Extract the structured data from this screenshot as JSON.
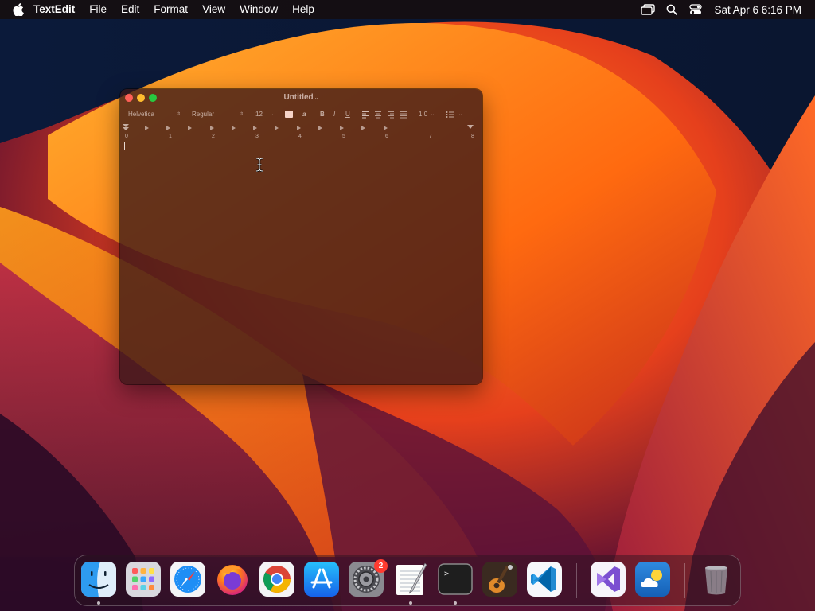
{
  "menubar": {
    "apple_icon": "apple-logo-icon",
    "app_name": "TextEdit",
    "items": [
      "File",
      "Edit",
      "Format",
      "View",
      "Window",
      "Help"
    ],
    "status_icons": [
      "screen-mirroring-icon",
      "spotlight-search-icon",
      "control-center-icon"
    ],
    "clock": "Sat Apr 6  6:16 PM"
  },
  "window": {
    "title": "Untitled",
    "traffic_lights": {
      "close": "#fe5f57",
      "minimize": "#febc2e",
      "zoom": "#28c840"
    },
    "toolbar": {
      "font_family": "Helvetica",
      "font_style": "Regular",
      "font_size": "12",
      "text_color": "#f5d3c8",
      "highlight_label": "a",
      "bold_label": "B",
      "italic_label": "I",
      "underline_label": "U",
      "line_spacing": "1.0"
    },
    "ruler": {
      "numbers": [
        "0",
        "1",
        "2",
        "3",
        "4",
        "5",
        "6",
        "7",
        "8"
      ]
    },
    "document_text": ""
  },
  "dock": {
    "apps": [
      {
        "name": "Finder",
        "icon": "finder-icon",
        "running": true
      },
      {
        "name": "Launchpad",
        "icon": "launchpad-icon",
        "running": false
      },
      {
        "name": "Safari",
        "icon": "safari-icon",
        "running": false
      },
      {
        "name": "Firefox",
        "icon": "firefox-icon",
        "running": false
      },
      {
        "name": "Google Chrome",
        "icon": "chrome-icon",
        "running": false
      },
      {
        "name": "App Store",
        "icon": "app-store-icon",
        "running": false
      },
      {
        "name": "System Settings",
        "icon": "system-settings-icon",
        "running": false,
        "badge": "2"
      },
      {
        "name": "TextEdit",
        "icon": "textedit-icon",
        "running": true
      },
      {
        "name": "Terminal",
        "icon": "terminal-icon",
        "running": true
      },
      {
        "name": "GarageBand",
        "icon": "garageband-icon",
        "running": false
      },
      {
        "name": "Visual Studio Code",
        "icon": "vscode-icon",
        "running": false
      },
      {
        "name": "Visual Studio",
        "icon": "visual-studio-icon",
        "running": false
      },
      {
        "name": "Weather",
        "icon": "weather-icon",
        "running": false
      },
      {
        "name": "Trash",
        "icon": "trash-icon",
        "running": false
      }
    ],
    "terminal_prompt": ">_"
  }
}
